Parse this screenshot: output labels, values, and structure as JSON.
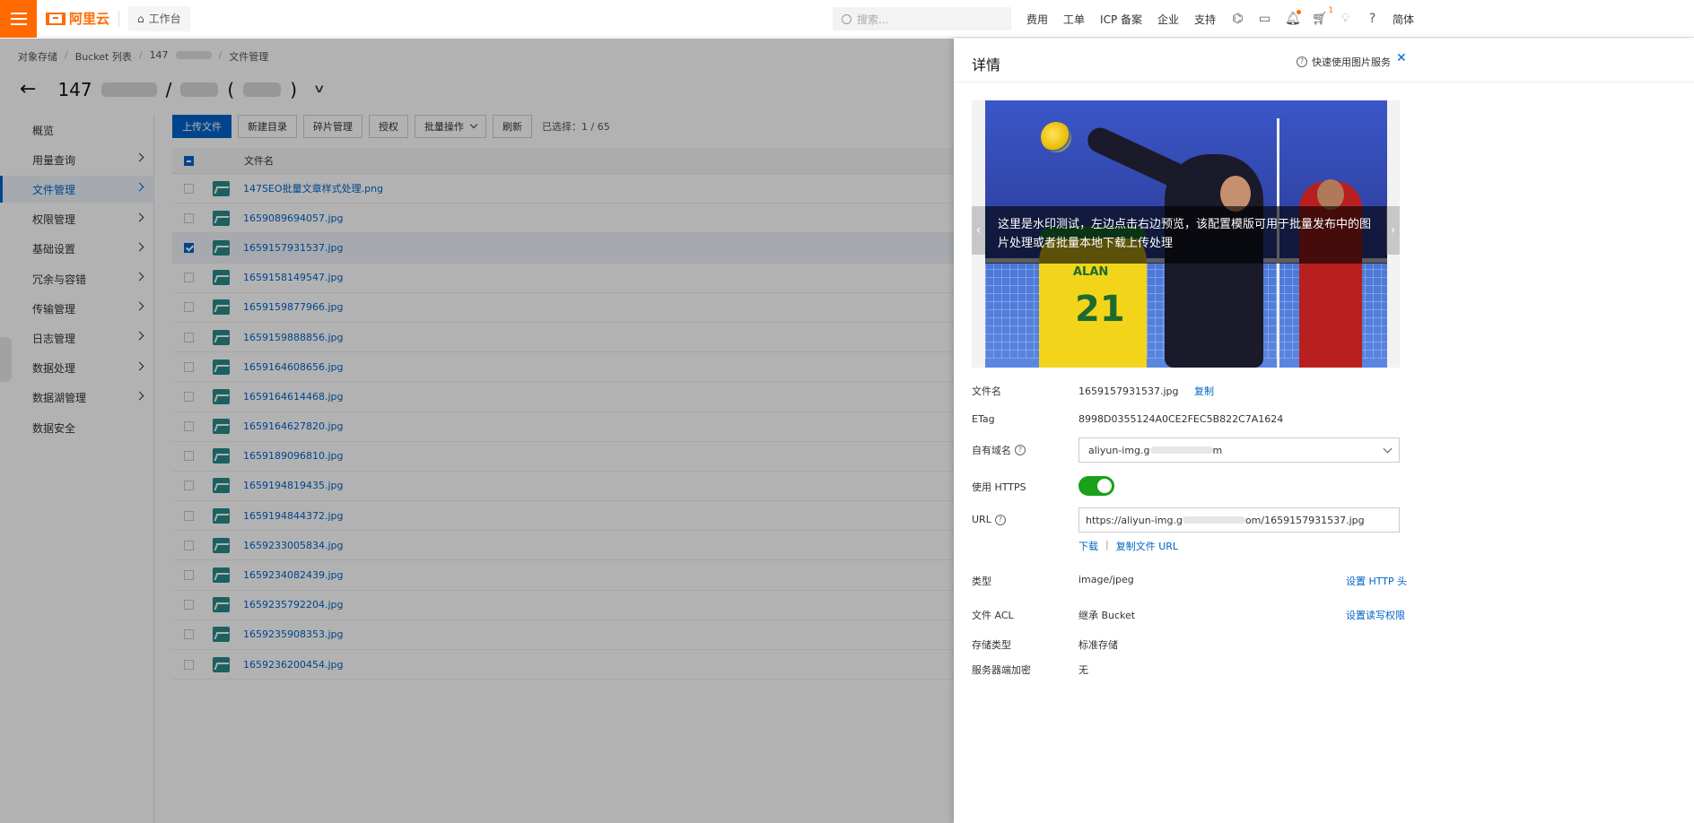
{
  "topbar": {
    "brand": "阿里云",
    "workbench": "工作台",
    "search_placeholder": "搜索...",
    "links": [
      "费用",
      "工单",
      "ICP 备案",
      "企业",
      "支持"
    ],
    "cart_count": "1",
    "language": "简体"
  },
  "breadcrumb": [
    "对象存储",
    "Bucket 列表",
    "147",
    "文件管理"
  ],
  "title": {
    "prefix": "147",
    "separator": "/",
    "paren_open": "(",
    "paren_close": ")"
  },
  "sidebar": {
    "items": [
      {
        "label": "概览",
        "has_arrow": false,
        "active": false
      },
      {
        "label": "用量查询",
        "has_arrow": true,
        "active": false
      },
      {
        "label": "文件管理",
        "has_arrow": true,
        "active": true
      },
      {
        "label": "权限管理",
        "has_arrow": true,
        "active": false
      },
      {
        "label": "基础设置",
        "has_arrow": true,
        "active": false
      },
      {
        "label": "冗余与容错",
        "has_arrow": true,
        "active": false
      },
      {
        "label": "传输管理",
        "has_arrow": true,
        "active": false
      },
      {
        "label": "日志管理",
        "has_arrow": true,
        "active": false
      },
      {
        "label": "数据处理",
        "has_arrow": true,
        "active": false
      },
      {
        "label": "数据湖管理",
        "has_arrow": true,
        "active": false
      },
      {
        "label": "数据安全",
        "has_arrow": false,
        "active": false
      }
    ]
  },
  "toolbar": {
    "upload": "上传文件",
    "new_dir": "新建目录",
    "fragments": "碎片管理",
    "authorize": "授权",
    "batch": "批量操作",
    "refresh": "刷新",
    "selected": "已选择：1 / 65"
  },
  "table": {
    "header_name": "文件名",
    "rows": [
      {
        "name": "147SEO批量文章样式处理.png",
        "checked": false
      },
      {
        "name": "1659089694057.jpg",
        "checked": false
      },
      {
        "name": "1659157931537.jpg",
        "checked": true
      },
      {
        "name": "1659158149547.jpg",
        "checked": false
      },
      {
        "name": "1659159877966.jpg",
        "checked": false
      },
      {
        "name": "1659159888856.jpg",
        "checked": false
      },
      {
        "name": "1659164608656.jpg",
        "checked": false
      },
      {
        "name": "1659164614468.jpg",
        "checked": false
      },
      {
        "name": "1659164627820.jpg",
        "checked": false
      },
      {
        "name": "1659189096810.jpg",
        "checked": false
      },
      {
        "name": "1659194819435.jpg",
        "checked": false
      },
      {
        "name": "1659194844372.jpg",
        "checked": false
      },
      {
        "name": "1659233005834.jpg",
        "checked": false
      },
      {
        "name": "1659234082439.jpg",
        "checked": false
      },
      {
        "name": "1659235792204.jpg",
        "checked": false
      },
      {
        "name": "1659235908353.jpg",
        "checked": false
      },
      {
        "name": "1659236200454.jpg",
        "checked": false
      }
    ]
  },
  "drawer": {
    "title": "详情",
    "help_link": "快速使用图片服务",
    "watermark_text": "这里是水印测试，左边点击右边预览，该配置模版可用于批量发布中的图片处理或者批量本地下载上传处理",
    "jersey_name": "ALAN",
    "jersey_number": "21",
    "fields": {
      "filename_label": "文件名",
      "filename_value": "1659157931537.jpg",
      "copy": "复制",
      "etag_label": "ETag",
      "etag_value": "8998D0355124A0CE2FEC5B822C7A1624",
      "domain_label": "自有域名",
      "domain_value_prefix": "aliyun-img.g",
      "domain_value_suffix": "m",
      "https_label": "使用 HTTPS",
      "https_enabled": true,
      "url_label": "URL",
      "url_prefix": "https://aliyun-img.g",
      "url_suffix": "om/1659157931537.jpg",
      "download": "下载",
      "pipe": "|",
      "copy_url": "复制文件 URL",
      "type_label": "类型",
      "type_value": "image/jpeg",
      "set_http_header": "设置 HTTP 头",
      "acl_label": "文件 ACL",
      "acl_value": "继承 Bucket",
      "set_acl": "设置读写权限",
      "storage_label": "存储类型",
      "storage_value": "标准存储",
      "encrypt_label": "服务器端加密",
      "encrypt_value": "无"
    }
  },
  "colors": {
    "brand_orange": "#ff6a00",
    "primary_blue": "#0064c8",
    "toggle_green": "#1aa01a"
  }
}
